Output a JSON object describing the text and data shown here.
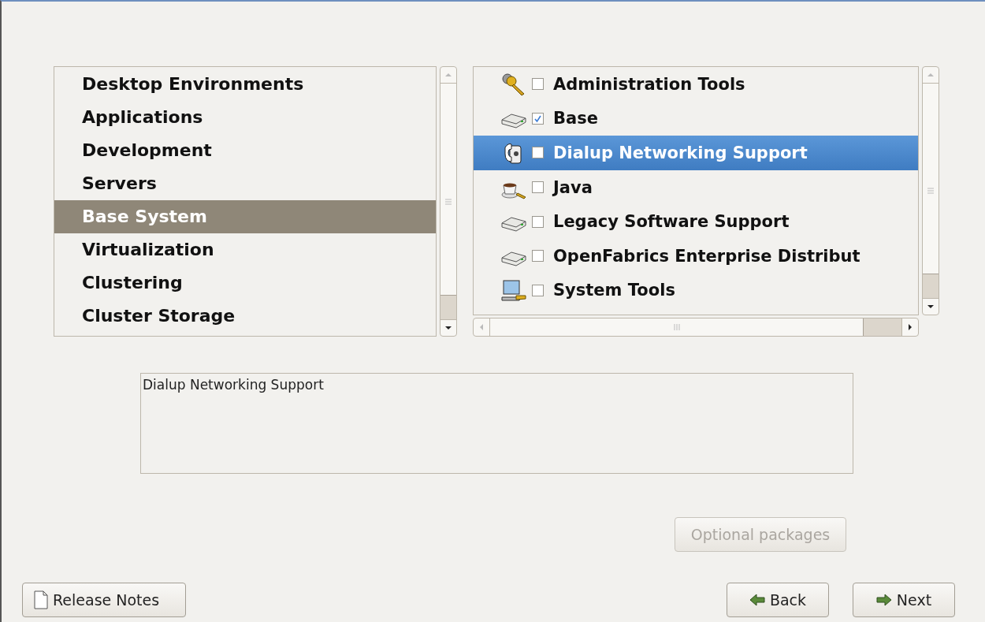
{
  "categories": [
    {
      "label": "Desktop Environments",
      "selected": false
    },
    {
      "label": "Applications",
      "selected": false
    },
    {
      "label": "Development",
      "selected": false
    },
    {
      "label": "Servers",
      "selected": false
    },
    {
      "label": "Base System",
      "selected": true
    },
    {
      "label": "Virtualization",
      "selected": false
    },
    {
      "label": "Clustering",
      "selected": false
    },
    {
      "label": "Cluster Storage",
      "selected": false
    }
  ],
  "groups": [
    {
      "kind": "keys",
      "label": "Administration Tools",
      "checked": false,
      "selected": false
    },
    {
      "kind": "disk",
      "label": "Base",
      "checked": true,
      "selected": false
    },
    {
      "kind": "phone",
      "label": "Dialup Networking Support",
      "checked": false,
      "selected": true
    },
    {
      "kind": "cup",
      "label": "Java",
      "checked": false,
      "selected": false
    },
    {
      "kind": "disk",
      "label": "Legacy Software Support",
      "checked": false,
      "selected": false
    },
    {
      "kind": "disk",
      "label": "OpenFabrics Enterprise Distribut",
      "checked": false,
      "selected": false
    },
    {
      "kind": "computer",
      "label": "System Tools",
      "checked": false,
      "selected": false
    }
  ],
  "description": "Dialup Networking Support",
  "optional_button": {
    "label": "Optional packages",
    "disabled": true
  },
  "release_notes_button": "Release Notes",
  "back_button": "Back",
  "next_button": "Next"
}
